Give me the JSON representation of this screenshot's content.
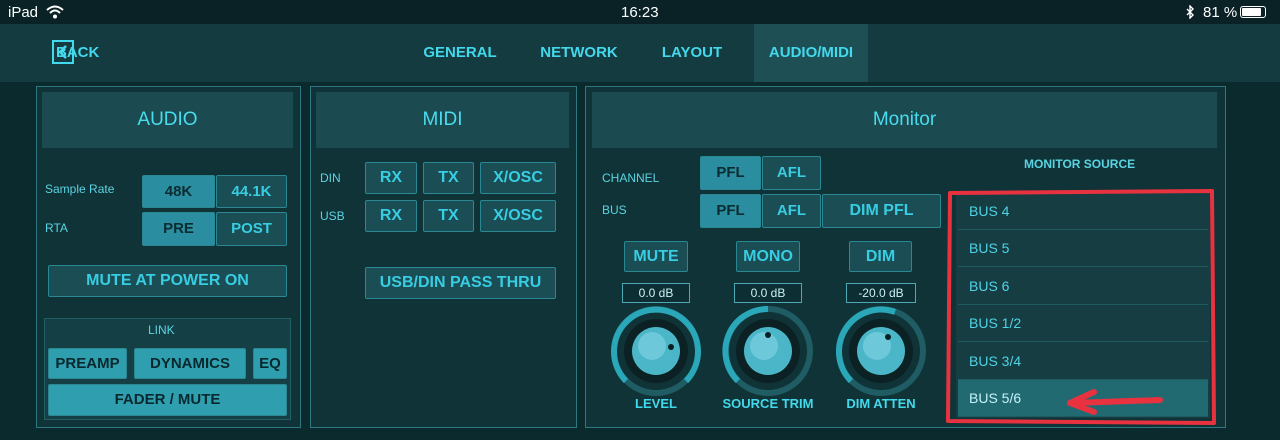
{
  "status": {
    "device": "iPad",
    "time": "16:23",
    "battery": "81 %"
  },
  "nav": {
    "back_label": "BACK",
    "tabs": [
      {
        "label": "GENERAL"
      },
      {
        "label": "NETWORK"
      },
      {
        "label": "LAYOUT"
      },
      {
        "label": "AUDIO/MIDI",
        "active": true
      }
    ]
  },
  "audio": {
    "title": "AUDIO",
    "sample_rate_label": "Sample Rate",
    "sample_rate_options": [
      "48K",
      "44.1K"
    ],
    "rta_label": "RTA",
    "rta_options": [
      "PRE",
      "POST"
    ],
    "mute_power_label": "MUTE AT POWER ON",
    "link_label": "LINK",
    "link_buttons": [
      "PREAMP",
      "DYNAMICS",
      "EQ"
    ],
    "fader_mute_label": "FADER / MUTE"
  },
  "midi": {
    "title": "MIDI",
    "din_label": "DIN",
    "usb_label": "USB",
    "buttons": [
      "RX",
      "TX",
      "X/OSC"
    ],
    "pass_thru_label": "USB/DIN PASS THRU"
  },
  "monitor": {
    "title": "Monitor",
    "channel_label": "CHANNEL",
    "bus_label": "BUS",
    "pfl_label": "PFL",
    "afl_label": "AFL",
    "dim_pfl_label": "DIM PFL",
    "mute_label": "MUTE",
    "mono_label": "MONO",
    "dim_label": "DIM",
    "level_value": "0.0 dB",
    "trim_value": "0.0 dB",
    "dim_value": "-20.0 dB",
    "level_label": "LEVEL",
    "trim_label": "SOURCE TRIM",
    "atten_label": "DIM ATTEN",
    "source_label": "MONITOR SOURCE",
    "sources": [
      "BUS 4",
      "BUS 5",
      "BUS 6",
      "BUS 1/2",
      "BUS 3/4",
      "BUS 5/6"
    ],
    "selected_source": "BUS 5/6"
  },
  "colors": {
    "accent": "#43d9ec",
    "annotation": "#e8323f",
    "background": "#0b2a2e"
  }
}
